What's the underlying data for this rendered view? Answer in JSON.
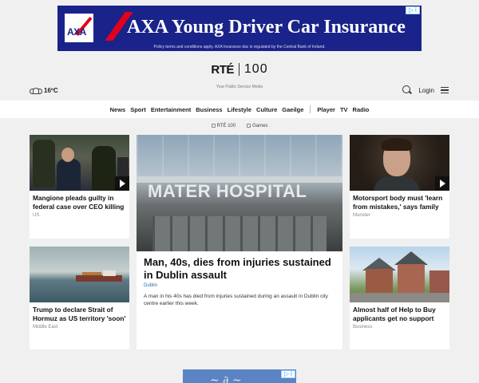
{
  "ad_top": {
    "headline": "AXA Young Driver Car Insurance",
    "logo_text": "AXA",
    "subtext": "Policy terms and conditions apply. AXA Insurance dac is regulated by the Central Bank of Ireland.",
    "brand_color": "#1a2389",
    "accent_color": "#e3001b"
  },
  "header": {
    "logo_rte": "RTÉ",
    "logo_100": "100",
    "tagline": "Your Public Service Media",
    "weather": {
      "icon": "cloud-icon",
      "temperature": "16ºC"
    },
    "login_label": "Login"
  },
  "nav": {
    "items": [
      "News",
      "Sport",
      "Entertainment",
      "Business",
      "Lifestyle",
      "Culture",
      "Gaeilge"
    ],
    "media_items": [
      "Player",
      "TV",
      "Radio"
    ]
  },
  "subnav": {
    "items": [
      "RTÉ 100",
      "Games"
    ]
  },
  "cards": {
    "left_top": {
      "title": "Mangione pleads guilty in federal case over CEO killing",
      "tag": "US",
      "has_video": true
    },
    "left_bottom": {
      "title": "Trump to declare Strait of Hormuz as US territory 'soon'",
      "tag": "Middle East",
      "has_video": false
    },
    "center": {
      "title": "Man, 40s, dies from injuries sustained in Dublin assault",
      "tag": "Dublin",
      "description": "A man in his 40s has died from injuries sustained during an assault in Dublin city centre earlier this week.",
      "image_text": "MATER HOSPITAL"
    },
    "right_top": {
      "title": "Motorsport body must 'learn from mistakes,' says family",
      "tag": "Munster",
      "has_video": true
    },
    "right_bottom": {
      "title": "Almost half of Help to Buy applicants get no support",
      "tag": "Business",
      "has_video": false
    }
  },
  "ad_bottom": {
    "color": "#5b84c4"
  }
}
